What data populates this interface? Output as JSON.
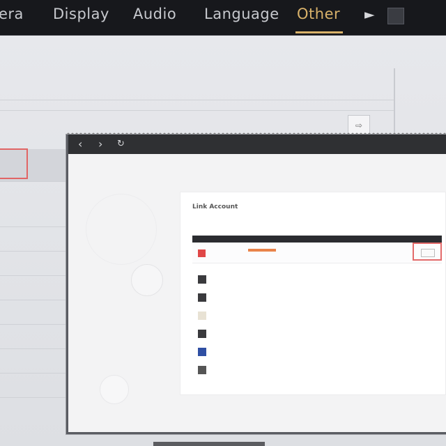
{
  "tabs": [
    {
      "label": "era",
      "active": false
    },
    {
      "label": "Display",
      "active": false
    },
    {
      "label": "Audio",
      "active": false
    },
    {
      "label": "Language",
      "active": false
    },
    {
      "label": "Other",
      "active": true
    }
  ],
  "colors": {
    "accent": "#d9b26a",
    "highlight_box": "#e16565",
    "link": "#4b90d9",
    "topbar": "#17181c"
  },
  "top_icons": [
    "cursor-icon",
    "square-icon"
  ],
  "browser": {
    "nav_icons": [
      "back-arrow-icon",
      "forward-arrow-icon",
      "refresh-icon"
    ],
    "background_button_icon": "arrow-right-icon"
  },
  "panel": {
    "title": "Link Account",
    "description": "",
    "section_header": "",
    "first_row": {
      "name": "",
      "subtitle": ""
    },
    "services": [
      {
        "icon": "service-icon-1",
        "name": "",
        "link": ""
      },
      {
        "icon": "service-icon-2",
        "name": "",
        "link": ""
      },
      {
        "icon": "service-icon-3",
        "name": "",
        "link": ""
      },
      {
        "icon": "service-icon-4",
        "name": "",
        "link": ""
      },
      {
        "icon": "service-icon-5",
        "name": "",
        "link": ""
      },
      {
        "icon": "service-icon-6",
        "name": "",
        "link": ""
      }
    ]
  }
}
